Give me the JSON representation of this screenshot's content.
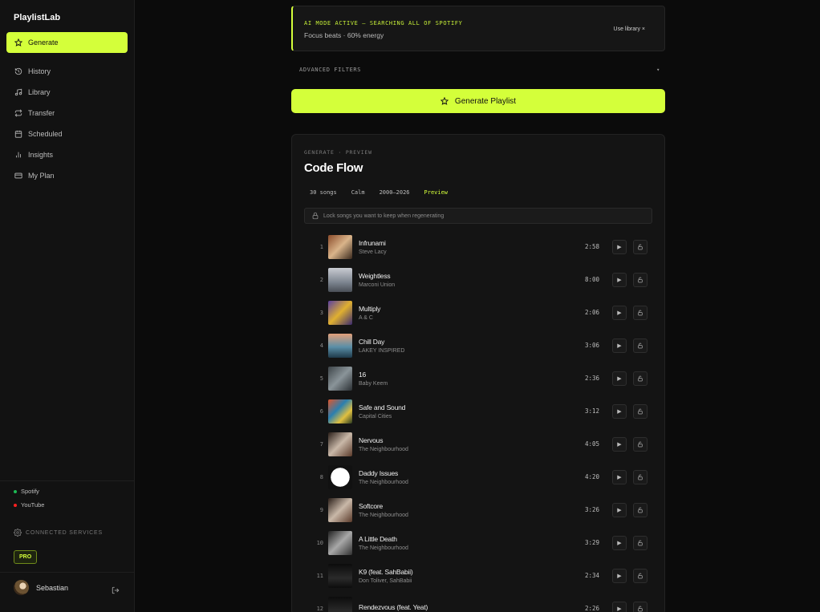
{
  "app": {
    "brand": "PlaylistLab",
    "colors": {
      "accent": "#d4ff3a",
      "spotify": "#1db954",
      "youtube": "#ff0000"
    }
  },
  "sidebar": {
    "active": {
      "label": "Generate",
      "icon": "star-icon"
    },
    "items": [
      {
        "label": "History",
        "icon": "history-icon"
      },
      {
        "label": "Library",
        "icon": "music-note-icon"
      },
      {
        "label": "Transfer",
        "icon": "transfer-icon"
      },
      {
        "label": "Scheduled",
        "icon": "calendar-icon"
      },
      {
        "label": "Insights",
        "icon": "bar-chart-icon"
      },
      {
        "label": "My Plan",
        "icon": "credit-card-icon"
      }
    ],
    "services": [
      {
        "label": "Spotify"
      },
      {
        "label": "YouTube"
      }
    ],
    "connected_label": "CONNECTED SERVICES",
    "plan_badge": "PRO",
    "user": {
      "name": "Sebastian"
    }
  },
  "banner": {
    "title": "AI MODE ACTIVE — SEARCHING ALL OF SPOTIFY",
    "subtitle": "Focus beats · 60% energy",
    "link": "Use library ×"
  },
  "filters": {
    "label": "ADVANCED FILTERS",
    "toggle": "▾"
  },
  "generate_button": {
    "label": "Generate Playlist"
  },
  "playlist": {
    "eyebrow": "GENERATE · PREVIEW",
    "title": "Code Flow",
    "chips": [
      "30 songs",
      "Calm",
      "2000–2026",
      "Preview"
    ],
    "lock_hint": "Lock songs you want to keep when regenerating",
    "tracks": [
      {
        "n": "1",
        "title": "Infrunami",
        "artist": "Steve Lacy",
        "duration": "2:58"
      },
      {
        "n": "2",
        "title": "Weightless",
        "artist": "Marconi Union",
        "duration": "8:00"
      },
      {
        "n": "3",
        "title": "Multiply",
        "artist": "A & C",
        "duration": "2:06"
      },
      {
        "n": "4",
        "title": "Chill Day",
        "artist": "LAKEY INSPIRED",
        "duration": "3:06"
      },
      {
        "n": "5",
        "title": "16",
        "artist": "Baby Keem",
        "duration": "2:36"
      },
      {
        "n": "6",
        "title": "Safe and Sound",
        "artist": "Capital Cities",
        "duration": "3:12"
      },
      {
        "n": "7",
        "title": "Nervous",
        "artist": "The Neighbourhood",
        "duration": "4:05"
      },
      {
        "n": "8",
        "title": "Daddy Issues",
        "artist": "The Neighbourhood",
        "duration": "4:20"
      },
      {
        "n": "9",
        "title": "Softcore",
        "artist": "The Neighbourhood",
        "duration": "3:26"
      },
      {
        "n": "10",
        "title": "A Little Death",
        "artist": "The Neighbourhood",
        "duration": "3:29"
      },
      {
        "n": "11",
        "title": "K9 (feat. SahBabii)",
        "artist": "Don Toliver, SahBabii",
        "duration": "2:34"
      },
      {
        "n": "12",
        "title": "Rendezvous (feat. Yeat)",
        "artist": "",
        "duration": "2:26"
      }
    ],
    "play_glyph": "▶"
  }
}
